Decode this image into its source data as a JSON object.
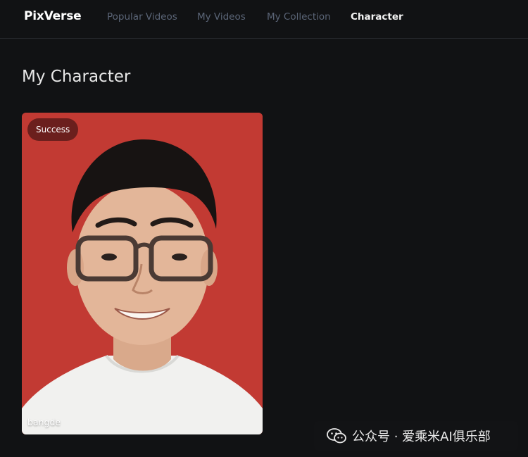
{
  "header": {
    "logo": "PixVerse",
    "nav": [
      {
        "label": "Popular Videos",
        "active": false
      },
      {
        "label": "My Videos",
        "active": false
      },
      {
        "label": "My Collection",
        "active": false
      },
      {
        "label": "Character",
        "active": true
      }
    ]
  },
  "main": {
    "title": "My Character",
    "characters": [
      {
        "status": "Success",
        "name": "bangde",
        "background_color": "#c23a33",
        "status_color": "#6b1f1d"
      }
    ]
  },
  "watermark": {
    "text": "公众号 · 爱乘米AI俱乐部",
    "icon": "wechat-icon"
  },
  "colors": {
    "background": "#111214",
    "nav_inactive": "#5b6577",
    "nav_active": "#f2f2f2"
  }
}
